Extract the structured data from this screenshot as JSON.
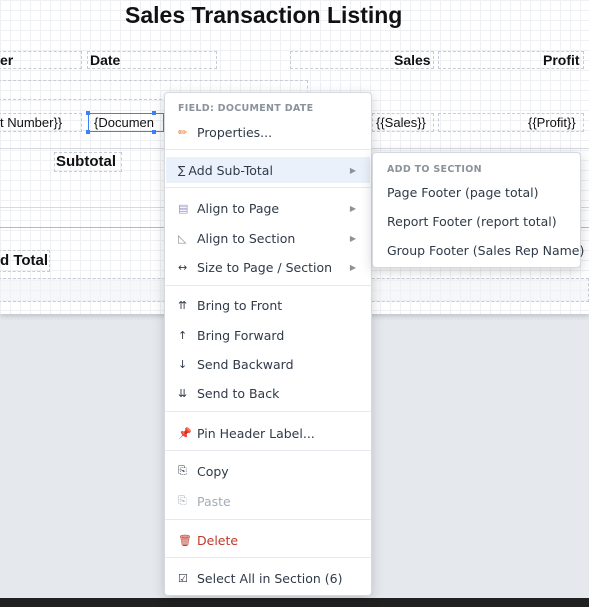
{
  "report": {
    "title": "Sales Transaction Listing",
    "headers": {
      "number_partial": "er",
      "date": "Date",
      "sales": "Sales",
      "profit": "Profit"
    },
    "fields": {
      "number_partial": "t Number}}",
      "document": "{Documen",
      "sales": "{{Sales}}",
      "profit": "{{Profit}}"
    },
    "subtotal_label": "Subtotal",
    "grand_total_partial": "d Total"
  },
  "context_menu": {
    "header": "FIELD: DOCUMENT DATE",
    "items": [
      {
        "icon": "✏",
        "label": "Properties...",
        "has_submenu": false
      },
      {
        "icon": "∑",
        "label": "Add Sub-Total",
        "has_submenu": true,
        "highlighted": true
      },
      {
        "icon": "▤",
        "label": "Align to Page",
        "has_submenu": true
      },
      {
        "icon": "◺",
        "label": "Align to Section",
        "has_submenu": true
      },
      {
        "icon": "↔",
        "label": "Size to Page / Section",
        "has_submenu": true
      },
      {
        "icon": "⇈",
        "label": "Bring to Front"
      },
      {
        "icon": "↑",
        "label": "Bring Forward"
      },
      {
        "icon": "↓",
        "label": "Send Backward"
      },
      {
        "icon": "⇊",
        "label": "Send to Back"
      },
      {
        "icon": "📌",
        "label": "Pin Header Label..."
      },
      {
        "icon": "⎘",
        "label": "Copy"
      },
      {
        "icon": "⎘",
        "label": "Paste",
        "disabled": true
      },
      {
        "icon": "🗑",
        "label": "Delete",
        "danger": true
      },
      {
        "icon": "☑",
        "label": "Select All in Section (6)"
      }
    ],
    "submenu_arrow": "▶"
  },
  "submenu": {
    "header": "ADD TO SECTION",
    "items": [
      "Page Footer (page total)",
      "Report Footer (report total)",
      "Group Footer (Sales Rep Name)"
    ]
  },
  "colors": {
    "accent": "#3b82f6",
    "highlight": "#eaf1fb",
    "danger": "#c0392b",
    "pin_icon": "#d04a6a",
    "edit_icon": "#e8792b"
  }
}
